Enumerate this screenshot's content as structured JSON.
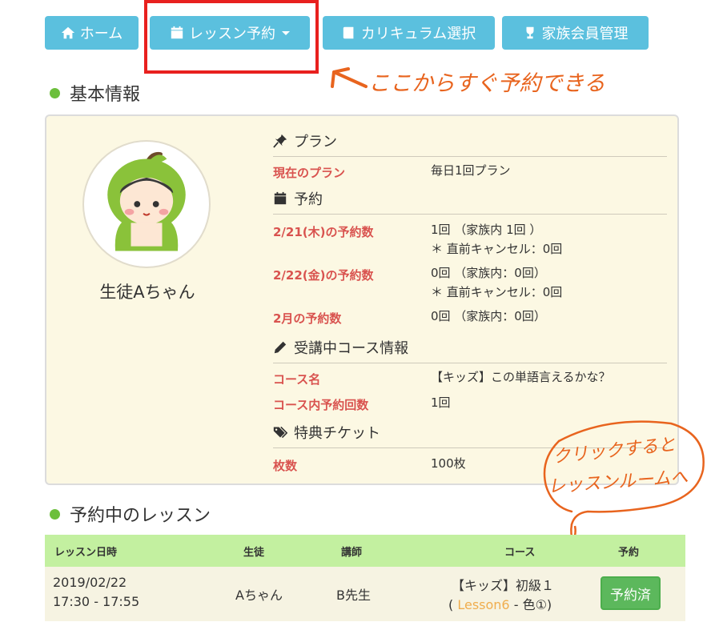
{
  "nav": {
    "home": "ホーム",
    "reserve": "レッスン予約",
    "curriculum": "カリキュラム選択",
    "family": "家族会員管理"
  },
  "annotations": {
    "reserve_hint": "ここからすぐ予約できる",
    "enter_line1": "クリックすると",
    "enter_line2": "レッスンルームへ"
  },
  "basic_info": {
    "title": "基本情報",
    "student_name": "生徒Aちゃん",
    "plan": {
      "header": "プラン",
      "current_label": "現在のプラン",
      "current_value": "毎日1回プラン"
    },
    "reservation": {
      "header": "予約",
      "rows": [
        {
          "label": "2/21(木)の予約数",
          "line1": "1回 （家族内 1回 ）",
          "line2": "＊ 直前キャンセル：0回"
        },
        {
          "label": "2/22(金)の予約数",
          "line1": "0回 （家族内：0回）",
          "line2": "＊ 直前キャンセル：0回"
        },
        {
          "label": "2月の予約数",
          "line1": "0回 （家族内：0回）"
        }
      ]
    },
    "course": {
      "header": "受講中コース情報",
      "name_label": "コース名",
      "name_value": "【キッズ】この単語言えるかな？",
      "count_label": "コース内予約回数",
      "count_value": "1回"
    },
    "ticket": {
      "header": "特典チケット",
      "count_label": "枚数",
      "count_value": "100枚"
    }
  },
  "lessons": {
    "title": "予約中のレッスン",
    "columns": [
      "レッスン日時",
      "生徒",
      "講師",
      "コース",
      "予約"
    ],
    "rows": [
      {
        "date": "2019/02/22",
        "time": "17:30 - 17:55",
        "student": "Aちゃん",
        "teacher": "B先生",
        "course_name": "【キッズ】初級１",
        "paren_open": "(",
        "lesson_link": "Lesson6",
        "lesson_rest": "- 色①)",
        "status": "予約済"
      }
    ]
  },
  "colors": {
    "nav": "#5bc0de",
    "label_red": "#d9534f",
    "annotation": "#e8641e",
    "table_header": "#c3f0a0",
    "done_button": "#5cb85c",
    "panel_bg": "#fcf8e3"
  }
}
